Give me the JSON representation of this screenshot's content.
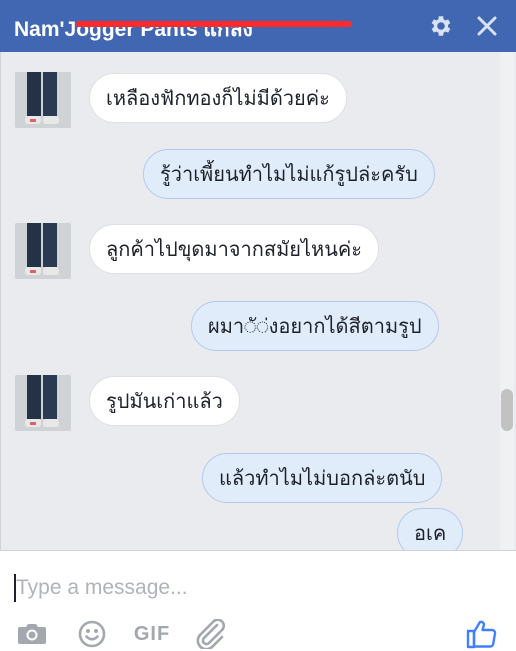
{
  "header": {
    "title": "Nam'Jogger Pants แกลง",
    "settings_icon": "gear-icon",
    "close_icon": "close-icon"
  },
  "messages": [
    {
      "side": "in",
      "text": "เหลืองฟักทองก็ไม่มีด้วยค่ะ"
    },
    {
      "side": "out",
      "text": "รู้ว่าเพี้ยนทำไมไม่แก้รูปล่ะครับ"
    },
    {
      "side": "in",
      "text": "ลูกค้าไปขุดมาจากสมัยไหนค่ะ"
    },
    {
      "side": "out",
      "text": "ผมา◌ั◌่งอยากได้สีตามรูป"
    },
    {
      "side": "in",
      "text": "รูปมันเก่าแล้ว"
    },
    {
      "side": "out",
      "text": "แล้วทำไมไม่บอกล่ะตนับ"
    },
    {
      "side": "out",
      "text": "อเค"
    }
  ],
  "composer": {
    "placeholder": "Type a message...",
    "value": "",
    "gif_label": "GIF"
  },
  "colors": {
    "header_bg": "#4267b2",
    "outgoing_bubble": "#e1ecfb",
    "incoming_bubble": "#ffffff",
    "like_blue": "#4080ff"
  }
}
